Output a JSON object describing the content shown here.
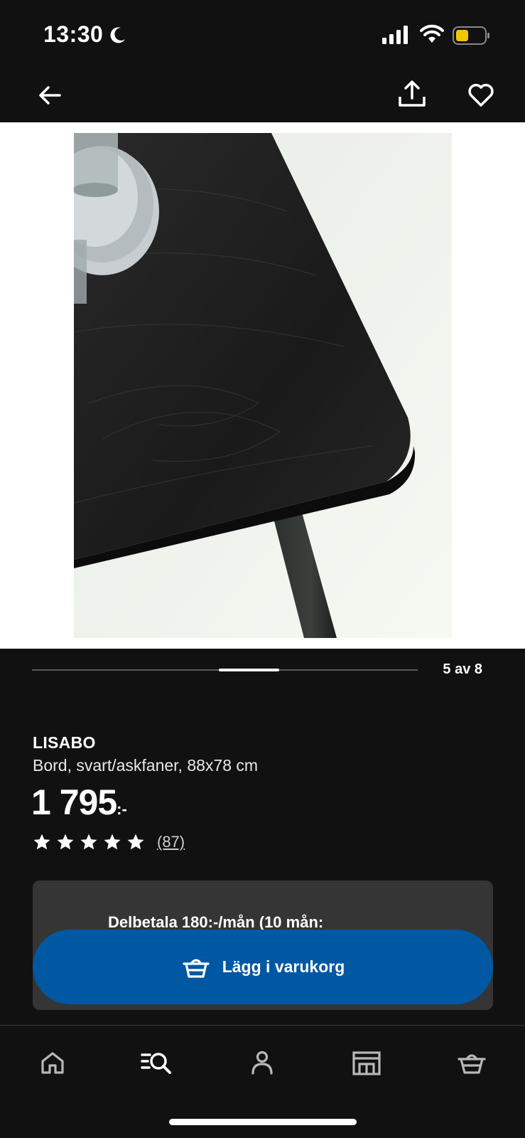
{
  "status_bar": {
    "time": "13:30",
    "moon_icon": "moon-icon",
    "signal_icon": "cellular-signal-icon",
    "wifi_icon": "wifi-icon",
    "battery_icon": "battery-icon",
    "battery_color": "#f5c400"
  },
  "nav": {
    "back_icon": "arrow-left-icon",
    "share_icon": "share-icon",
    "favorite_icon": "heart-icon"
  },
  "gallery": {
    "current": 5,
    "total": 8,
    "counter_text": "5 av 8",
    "image_description_icon": "product-photo"
  },
  "product": {
    "name": "LISABO",
    "description": "Bord, svart/askfaner, 88x78 cm",
    "price": "1 795",
    "price_suffix": ":-",
    "rating_stars": 5,
    "review_count": "(87)"
  },
  "payment": {
    "text": "Delbetala 180:-/mån (10 mån:"
  },
  "cta": {
    "label": "Lägg i varukorg",
    "icon": "shopping-basket-icon",
    "color": "#0058a3"
  },
  "tabbar": {
    "items": [
      {
        "icon": "home-icon"
      },
      {
        "icon": "search-list-icon"
      },
      {
        "icon": "profile-icon"
      },
      {
        "icon": "store-icon"
      },
      {
        "icon": "basket-icon"
      }
    ]
  }
}
